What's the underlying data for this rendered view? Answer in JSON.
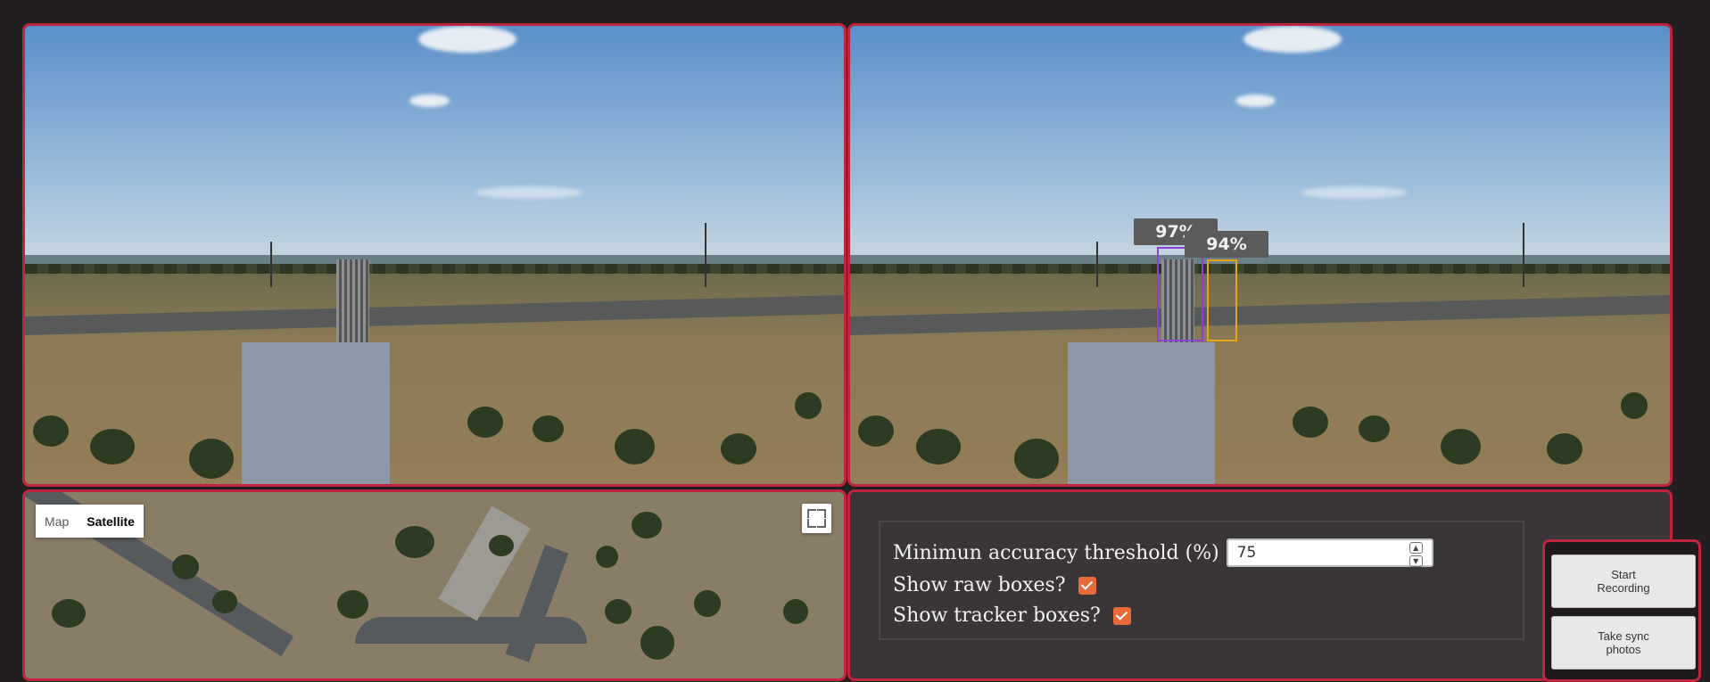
{
  "cameras": {
    "left": {
      "view": "raw camera feed"
    },
    "right": {
      "detections": [
        {
          "label": "97%",
          "color": "#8e3fd6"
        },
        {
          "label": "94%",
          "color": "#e8a317"
        }
      ]
    }
  },
  "map": {
    "toggle": {
      "map_label": "Map",
      "satellite_label": "Satellite",
      "selected": "Satellite"
    },
    "fullscreen_icon": "fullscreen-icon"
  },
  "settings": {
    "threshold_label": "Minimun accuracy threshold (%)",
    "threshold_value": "75",
    "raw_boxes_label": "Show raw boxes?",
    "raw_boxes_checked": true,
    "tracker_boxes_label": "Show tracker boxes?",
    "tracker_boxes_checked": true
  },
  "recording": {
    "start_label": "Start\nRecording",
    "sync_label": "Take sync\nphotos"
  },
  "colors": {
    "accent": "#c0253f",
    "checkbox": "#e66a3a",
    "background": "#231f20"
  }
}
